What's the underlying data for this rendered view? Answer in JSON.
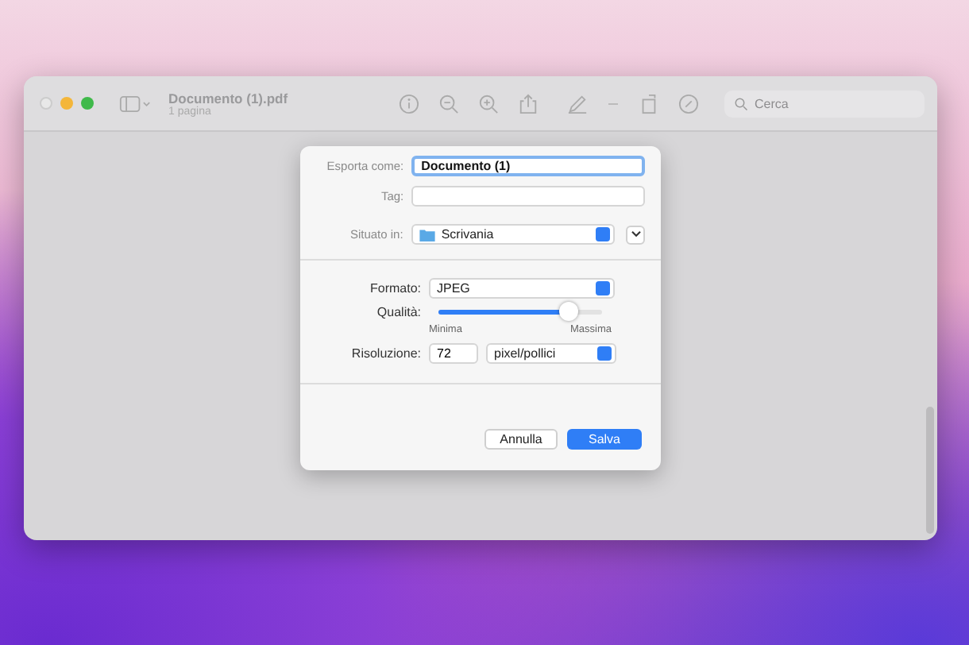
{
  "window": {
    "title": "Documento (1).pdf",
    "subtitle": "1 pagina",
    "search": {
      "placeholder": "Cerca"
    }
  },
  "dialog": {
    "export_as": {
      "label": "Esporta come:",
      "value": "Documento (1)"
    },
    "tag": {
      "label": "Tag:"
    },
    "location": {
      "label": "Situato in:",
      "value": "Scrivania"
    },
    "format": {
      "label": "Formato:",
      "value": "JPEG"
    },
    "quality": {
      "label": "Qualità:",
      "level": 0.8,
      "min_label": "Minima",
      "max_label": "Massima"
    },
    "resolution": {
      "label": "Risoluzione:",
      "value": "72",
      "unit": "pixel/pollici"
    },
    "buttons": [
      {
        "label": "Annulla",
        "kind": "secondary"
      },
      {
        "label": "Salva",
        "kind": "primary"
      }
    ]
  }
}
